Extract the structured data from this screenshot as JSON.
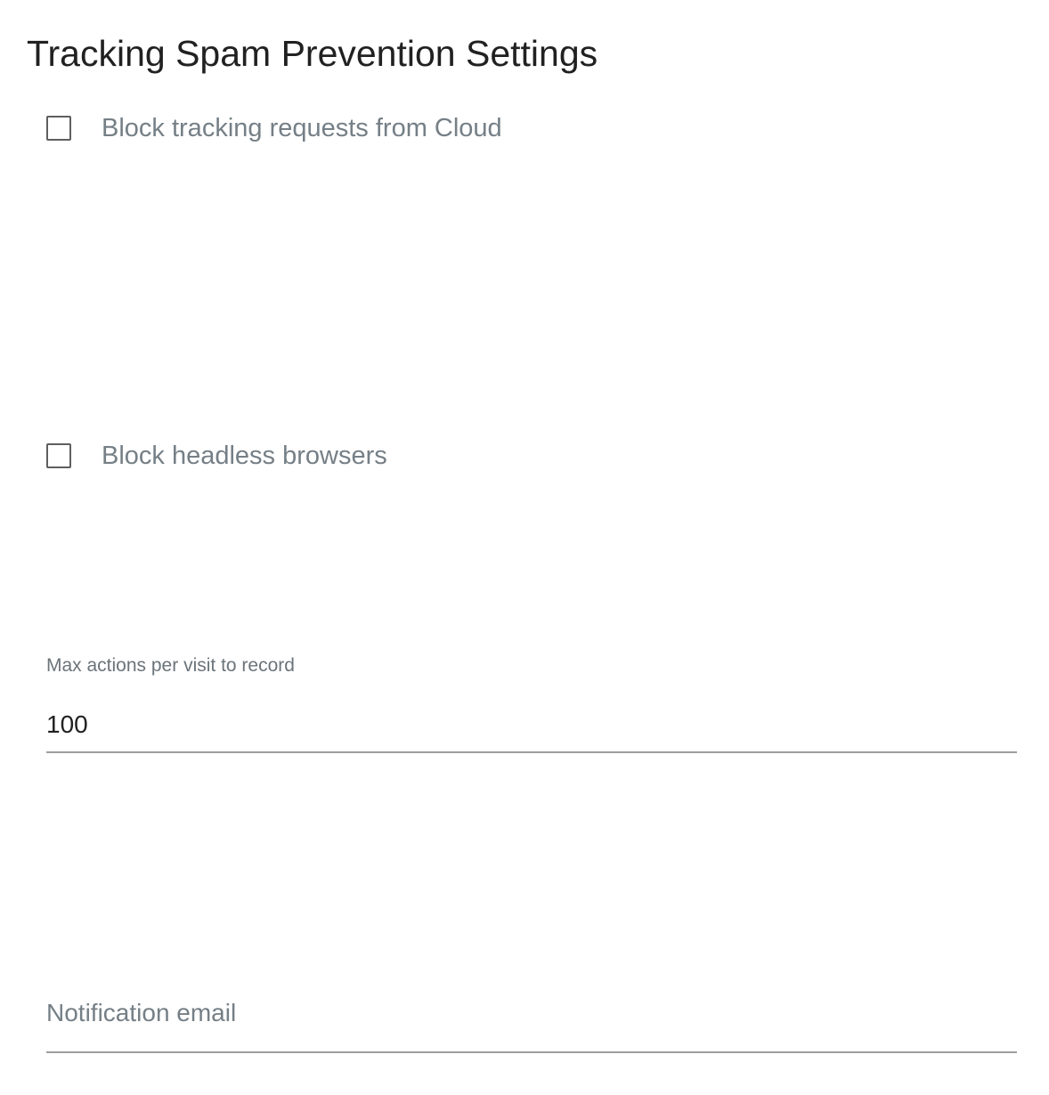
{
  "page": {
    "title": "Tracking Spam Prevention Settings"
  },
  "settings": {
    "block_cloud": {
      "label": "Block tracking requests from Cloud",
      "checked": false
    },
    "block_headless": {
      "label": "Block headless browsers",
      "checked": false
    },
    "max_actions": {
      "label": "Max actions per visit to record",
      "value": "100"
    },
    "notification_email": {
      "placeholder": "Notification email",
      "value": ""
    }
  },
  "colors": {
    "title_text": "#212121",
    "label_text": "#757f86",
    "input_underline": "#9e9e9e",
    "checkbox_border": "#5f5f5f"
  }
}
